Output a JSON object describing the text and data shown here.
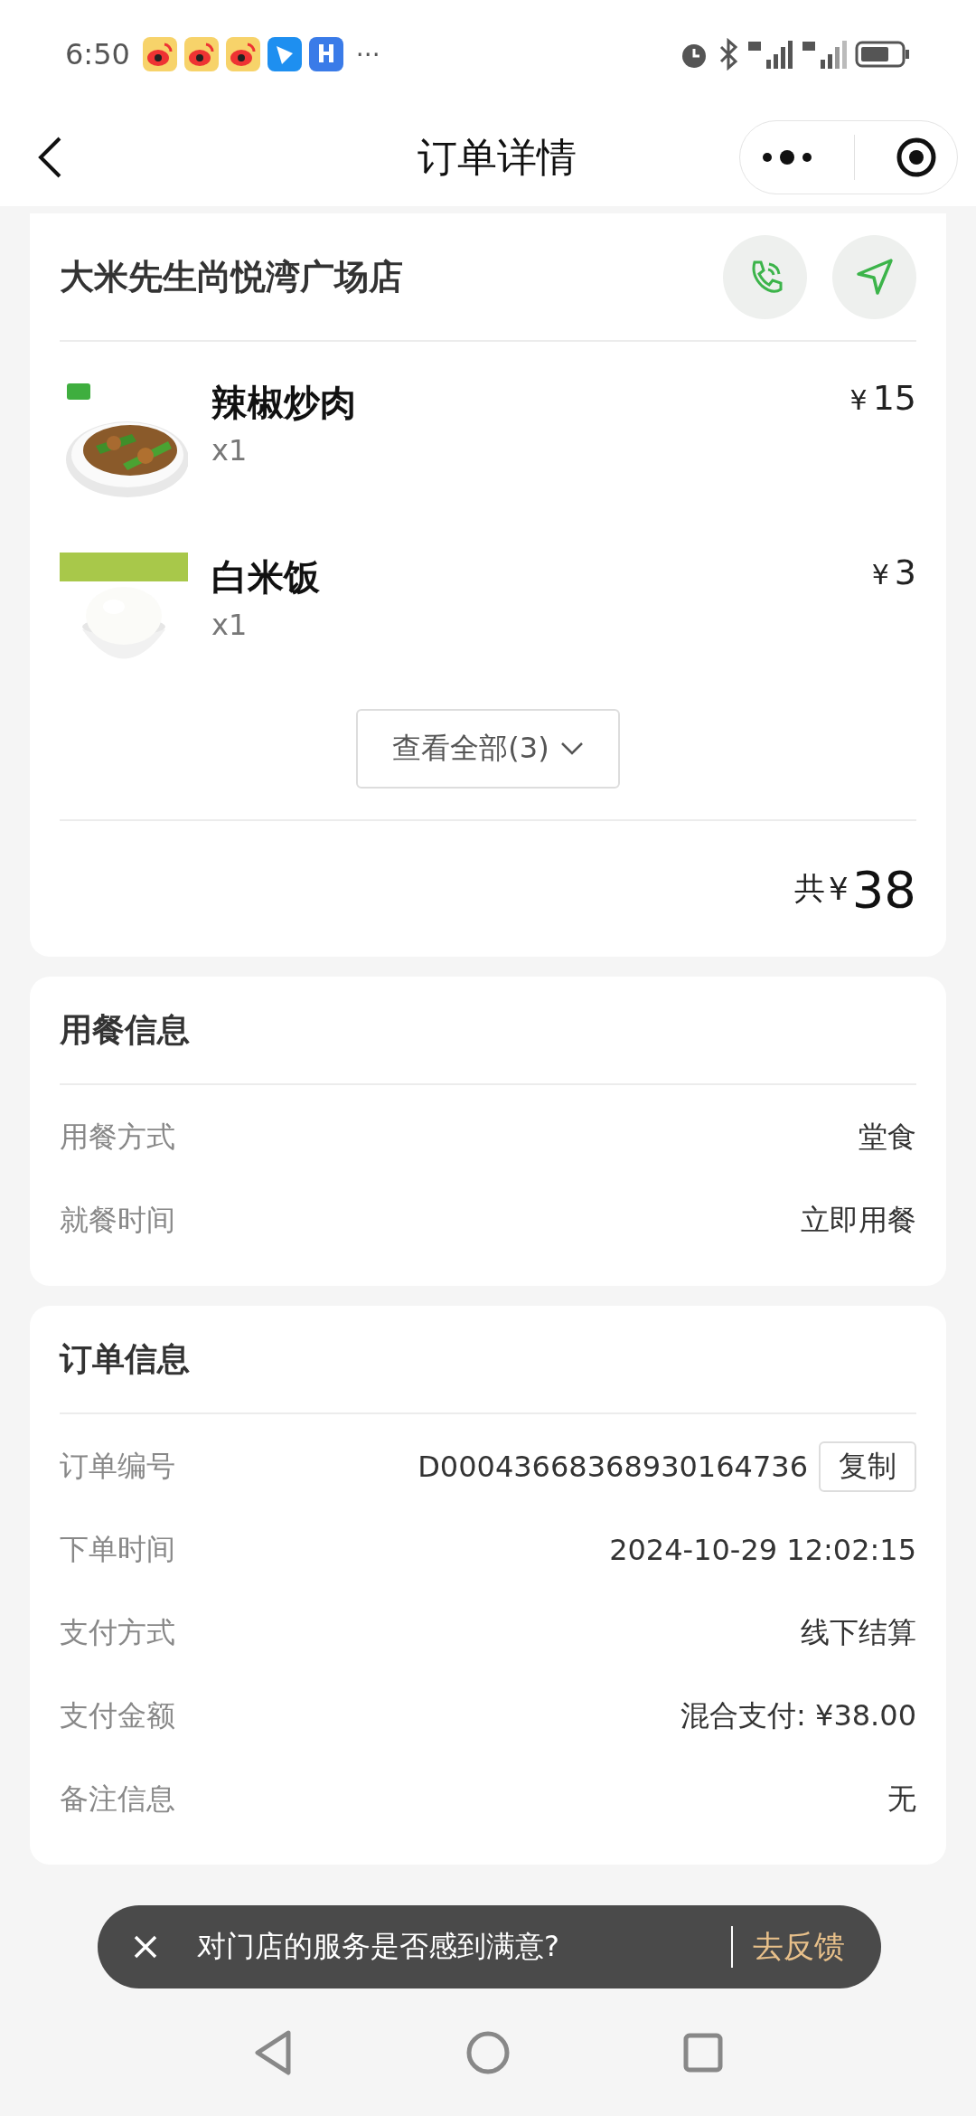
{
  "status_bar": {
    "time": "6:50",
    "more": "···"
  },
  "header": {
    "title": "订单详情"
  },
  "store": {
    "name": "大米先生尚悦湾广场店"
  },
  "items": [
    {
      "name": "辣椒炒肉",
      "qty": "x1",
      "currency": "¥",
      "price": "15",
      "kind": "picture"
    },
    {
      "name": "白米饭",
      "qty": "x1",
      "currency": "¥",
      "price": "3",
      "kind": "picture"
    }
  ],
  "view_all": "查看全部(3)",
  "total": {
    "label": "共",
    "currency": "¥",
    "amount": "38"
  },
  "dining": {
    "title": "用餐信息",
    "rows": [
      {
        "label": "用餐方式",
        "value": "堂食"
      },
      {
        "label": "就餐时间",
        "value": "立即用餐"
      }
    ]
  },
  "order": {
    "title": "订单信息",
    "rows": [
      {
        "label": "订单编号",
        "value": "D00043668368930164736",
        "action": "复制"
      },
      {
        "label": "下单时间",
        "value": "2024-10-29 12:02:15"
      },
      {
        "label": "支付方式",
        "value": "线下结算"
      },
      {
        "label": "支付金额",
        "value": "混合支付: ¥38.00"
      },
      {
        "label": "备注信息",
        "value": "无"
      }
    ]
  },
  "toast": {
    "message": "对门店的服务是否感到满意?",
    "action": "去反馈"
  }
}
